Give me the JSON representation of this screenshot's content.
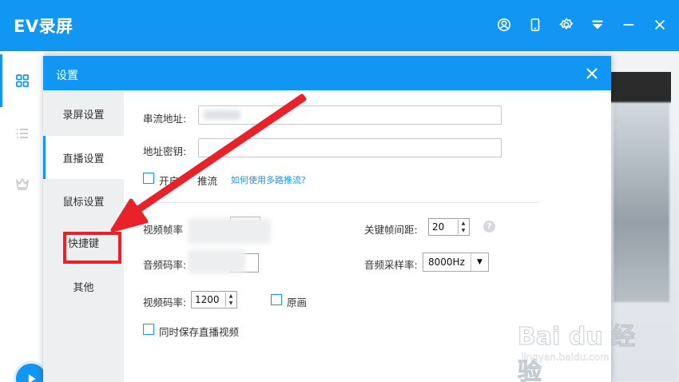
{
  "app": {
    "title": "EV录屏",
    "accent": "#1296f3",
    "header_icons": [
      "user-icon",
      "tablet-icon",
      "settings-icon",
      "dropdown-icon",
      "minimize-icon",
      "close-icon"
    ],
    "sidebar_icons": [
      "grid-icon",
      "list-icon",
      "crown-icon"
    ]
  },
  "dialog": {
    "title": "设置",
    "nav": [
      {
        "label": "录屏设置"
      },
      {
        "label": "直播设置",
        "active": true
      },
      {
        "label": "鼠标设置"
      },
      {
        "label": "快捷键"
      },
      {
        "label": "其他"
      }
    ],
    "stream_url": {
      "label": "串流地址:",
      "value": ""
    },
    "stream_key": {
      "label": "地址密钥:",
      "value": ""
    },
    "multi_push": {
      "label_start": "开启",
      "label_end": "推流",
      "checked": false
    },
    "multi_push_link": "如何使用多路推流?",
    "video_fps": {
      "label": "视频帧率"
    },
    "keyframe_interval": {
      "label": "关键帧间距:",
      "value": "20"
    },
    "audio_bitrate": {
      "label": "音频码率:"
    },
    "audio_samplerate": {
      "label": "音频采样率:",
      "value": "8000Hz"
    },
    "video_bitrate": {
      "label": "视频码率:",
      "value": "1200"
    },
    "original": {
      "label": "原画",
      "checked": false
    },
    "save_live": {
      "label": "同时保存直播视频",
      "checked": false
    }
  },
  "annotation": {
    "highlight_color": "#e8212b"
  },
  "watermark": {
    "main": "Bai du 经验",
    "sub": "jingyan.baidu.com"
  }
}
